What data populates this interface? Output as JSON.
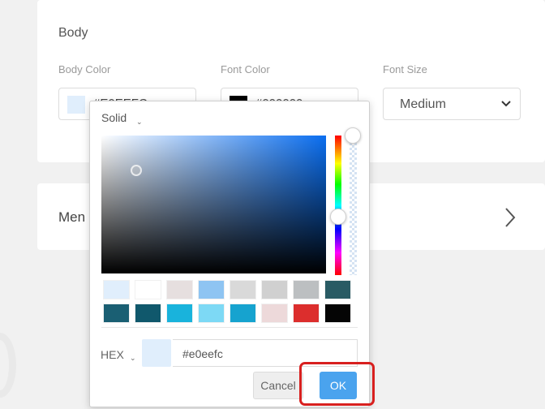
{
  "body_section": {
    "title": "Body",
    "body_color": {
      "label": "Body Color",
      "value": "#E0EEFC",
      "swatch": "#e0eefc"
    },
    "font_color": {
      "label": "Font Color",
      "value": "#000000",
      "swatch": "#000000"
    },
    "font_size": {
      "label": "Font Size",
      "selected": "Medium"
    }
  },
  "menu_section": {
    "title": "Men"
  },
  "picker": {
    "mode_label": "Solid",
    "main_color": "#0a6ef0",
    "presets": [
      "#e0eefc",
      "#ffffff",
      "#e6dfdf",
      "#8ec4f2",
      "#d9d9d9",
      "#d0d0d0",
      "#bcbfc1",
      "#295b64",
      "#1a5f73",
      "#10586c",
      "#19b3dc",
      "#7dd9f5",
      "#16a3cf",
      "#edd9da",
      "#dc2e2d",
      "#050505"
    ],
    "hex_label": "HEX",
    "hex_value": "#e0eefc",
    "hex_swatch": "#e0eefc",
    "cancel_label": "Cancel",
    "ok_label": "OK"
  }
}
